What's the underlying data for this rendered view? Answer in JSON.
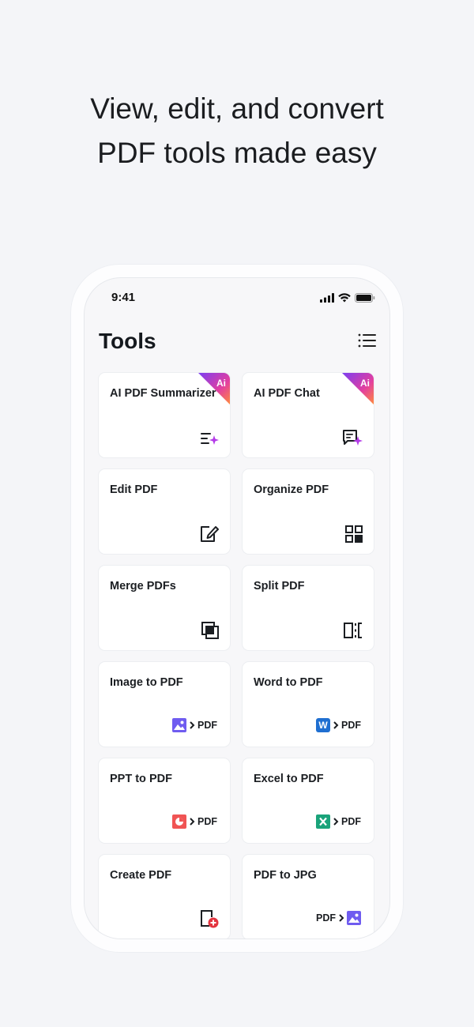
{
  "headline": {
    "line1": "View, edit, and convert",
    "line2": "PDF tools made easy"
  },
  "status_bar": {
    "time": "9:41",
    "icons": [
      "cellular-signal-icon",
      "wifi-icon",
      "battery-icon"
    ]
  },
  "page": {
    "title": "Tools",
    "menu_icon": "list-view-icon"
  },
  "tools": [
    {
      "label": "AI PDF Summarizer",
      "icon": "summarize-sparkle-icon",
      "badge": "Ai"
    },
    {
      "label": "AI PDF Chat",
      "icon": "chat-sparkle-icon",
      "badge": "Ai"
    },
    {
      "label": "Edit PDF",
      "icon": "edit-document-icon"
    },
    {
      "label": "Organize PDF",
      "icon": "grid-organize-icon"
    },
    {
      "label": "Merge PDFs",
      "icon": "merge-icon"
    },
    {
      "label": "Split PDF",
      "icon": "split-icon"
    },
    {
      "label": "Image to PDF",
      "icon": "image-file-icon",
      "conv_text": "PDF"
    },
    {
      "label": "Word to PDF",
      "icon": "word-file-icon",
      "conv_letter": "W",
      "conv_text": "PDF"
    },
    {
      "label": "PPT to PDF",
      "icon": "ppt-file-icon",
      "conv_text": "PDF"
    },
    {
      "label": "Excel to PDF",
      "icon": "excel-file-icon",
      "conv_text": "PDF"
    },
    {
      "label": "Create PDF",
      "icon": "create-document-icon"
    },
    {
      "label": "PDF to JPG",
      "icon": "image-file-icon",
      "conv_text": "PDF"
    }
  ],
  "colors": {
    "ai_badge_gradient": [
      "#7b3ff2",
      "#e23fa0",
      "#ff8a3d"
    ],
    "image_icon": "#6f5cf0",
    "word_icon": "#1f6fd1",
    "ppt_icon": "#f05454",
    "excel_icon": "#1aa37a",
    "create_plus": "#e3343f"
  }
}
